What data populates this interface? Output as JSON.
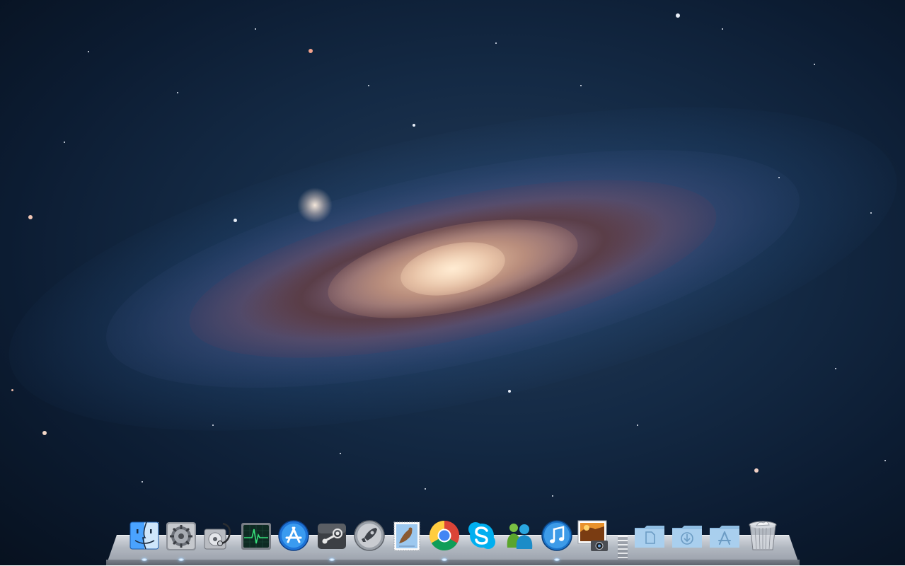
{
  "desktop": {
    "wallpaper": "andromeda-galaxy",
    "colors": {
      "sky_dark": "#07111f",
      "sky_mid": "#142a45",
      "galaxy_core": "#f0cdaa",
      "galaxy_arm": "#aa786e"
    }
  },
  "dock": {
    "apps": [
      {
        "id": "finder",
        "icon": "finder-icon",
        "running": true
      },
      {
        "id": "system-preferences",
        "icon": "gear-icon",
        "running": true
      },
      {
        "id": "disk-utility",
        "icon": "disk-stethoscope-icon",
        "running": false
      },
      {
        "id": "activity-monitor",
        "icon": "activity-monitor-icon",
        "running": false
      },
      {
        "id": "app-store",
        "icon": "app-store-icon",
        "running": false
      },
      {
        "id": "steam",
        "icon": "steam-icon",
        "running": true
      },
      {
        "id": "launchpad",
        "icon": "rocket-icon",
        "running": false
      },
      {
        "id": "mail",
        "icon": "mail-stamp-icon",
        "running": false
      },
      {
        "id": "chrome",
        "icon": "chrome-icon",
        "running": true
      },
      {
        "id": "skype",
        "icon": "skype-icon",
        "running": false
      },
      {
        "id": "messenger",
        "icon": "messenger-people-icon",
        "running": false
      },
      {
        "id": "itunes",
        "icon": "itunes-note-icon",
        "running": true
      },
      {
        "id": "iphoto",
        "icon": "iphoto-icon",
        "running": false
      }
    ],
    "stacks": [
      {
        "id": "documents",
        "icon": "documents-folder-icon"
      },
      {
        "id": "downloads",
        "icon": "downloads-folder-icon"
      },
      {
        "id": "applications",
        "icon": "applications-folder-icon"
      },
      {
        "id": "trash",
        "icon": "trash-icon"
      }
    ]
  }
}
